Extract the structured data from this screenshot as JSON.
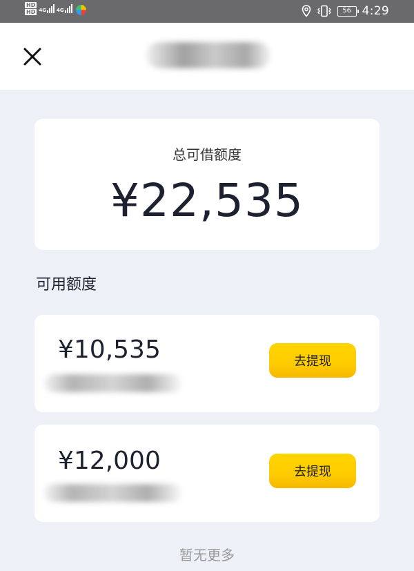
{
  "status_bar": {
    "hd_badges": [
      "HD",
      "HD"
    ],
    "network_labels": [
      "4G",
      "4G"
    ],
    "battery_level": "56",
    "time": "4:29",
    "icons": [
      "location-icon",
      "vibrate-icon",
      "battery-icon"
    ]
  },
  "header": {
    "close_icon": "close-icon"
  },
  "total": {
    "label": "总可借额度",
    "amount": "¥22,535"
  },
  "available": {
    "section_title": "可用额度",
    "items": [
      {
        "amount": "¥10,535",
        "button_label": "去提现"
      },
      {
        "amount": "¥12,000",
        "button_label": "去提现"
      }
    ]
  },
  "footer": {
    "note": "暂无更多"
  },
  "colors": {
    "status_bar": "#6a6a6c",
    "page_background": "#eef0f7",
    "button_yellow": "#ffcc00",
    "amount_text": "#1e2230",
    "muted_text": "#999999"
  }
}
